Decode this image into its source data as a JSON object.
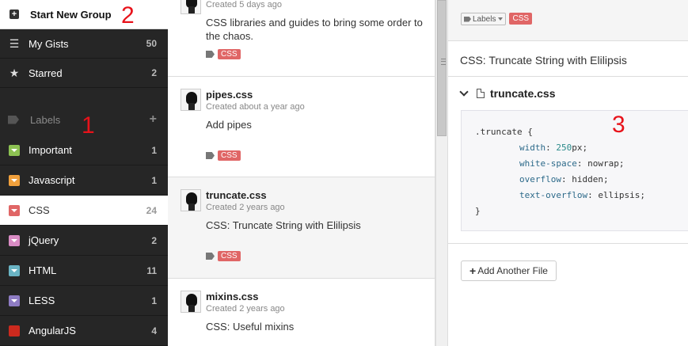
{
  "sidebar": {
    "start_new_label": "Start New Group",
    "nav": [
      {
        "label": "My Gists",
        "count": "50",
        "icon": "list-icon"
      },
      {
        "label": "Starred",
        "count": "2",
        "icon": "star-icon"
      }
    ],
    "labels_header": "Labels",
    "labels": [
      {
        "label": "Important",
        "count": "1",
        "color": "#8cc152"
      },
      {
        "label": "Javascript",
        "count": "1",
        "color": "#f0a03c"
      },
      {
        "label": "CSS",
        "count": "24",
        "color": "#e06666"
      },
      {
        "label": "jQuery",
        "count": "2",
        "color": "#d98cc4"
      },
      {
        "label": "HTML",
        "count": "11",
        "color": "#6ab4c4"
      },
      {
        "label": "LESS",
        "count": "1",
        "color": "#8e7cc3"
      },
      {
        "label": "AngularJS",
        "count": "4",
        "color": "#cc2a1e"
      }
    ]
  },
  "annotations": {
    "n1": "1",
    "n2": "2",
    "n3": "3"
  },
  "gists": [
    {
      "title": "",
      "meta": "Created 5 days ago",
      "desc": "CSS libraries and guides to bring some order to the chaos.",
      "tag": "CSS"
    },
    {
      "title": "pipes.css",
      "meta": "Created about a year ago",
      "desc": "Add pipes",
      "tag": "CSS"
    },
    {
      "title": "truncate.css",
      "meta": "Created 2 years ago",
      "desc": "CSS: Truncate String with Elilipsis",
      "tag": "CSS"
    },
    {
      "title": "mixins.css",
      "meta": "Created 2 years ago",
      "desc": "CSS: Useful mixins",
      "tag": ""
    }
  ],
  "detail": {
    "labels_dropdown": "Labels",
    "tag": "CSS",
    "description": "CSS: Truncate String with Elilipsis",
    "file_name": "truncate.css",
    "code": {
      "selector": ".truncate {",
      "lines": [
        {
          "prop": "width",
          "value_num": "250",
          "value_rest": "px;"
        },
        {
          "prop": "white-space",
          "value_num": "",
          "value_rest": " nowrap;"
        },
        {
          "prop": "overflow",
          "value_num": "",
          "value_rest": " hidden;"
        },
        {
          "prop": "text-overflow",
          "value_num": "",
          "value_rest": " ellipsis;"
        }
      ],
      "close": "}"
    },
    "add_file_label": "Add Another File"
  }
}
